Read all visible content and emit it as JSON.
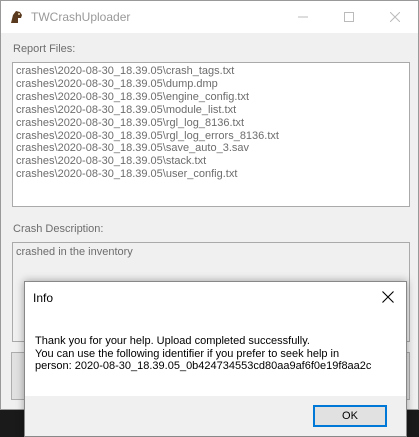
{
  "window": {
    "title": "TWCrashUploader",
    "report_files_label": "Report Files:",
    "report_files": [
      "crashes\\2020-08-30_18.39.05\\crash_tags.txt",
      "crashes\\2020-08-30_18.39.05\\dump.dmp",
      "crashes\\2020-08-30_18.39.05\\engine_config.txt",
      "crashes\\2020-08-30_18.39.05\\module_list.txt",
      "crashes\\2020-08-30_18.39.05\\rgl_log_8136.txt",
      "crashes\\2020-08-30_18.39.05\\rgl_log_errors_8136.txt",
      "crashes\\2020-08-30_18.39.05\\save_auto_3.sav",
      "crashes\\2020-08-30_18.39.05\\stack.txt",
      "crashes\\2020-08-30_18.39.05\\user_config.txt"
    ],
    "crash_description_label": "Crash Description:",
    "crash_description": "crashed in the inventory"
  },
  "dialog": {
    "title": "Info",
    "message_lines": [
      "Thank you for your help. Upload completed successfully.",
      "You can use the following identifier if you prefer to seek help in",
      "person: 2020-08-30_18.39.05_0b424734553cd80aa9af6f0e19f8aa2c"
    ],
    "ok_label": "OK",
    "close_icon": "close-icon"
  },
  "colors": {
    "accent": "#0078d7",
    "disabled_text": "#6d6d6d"
  }
}
